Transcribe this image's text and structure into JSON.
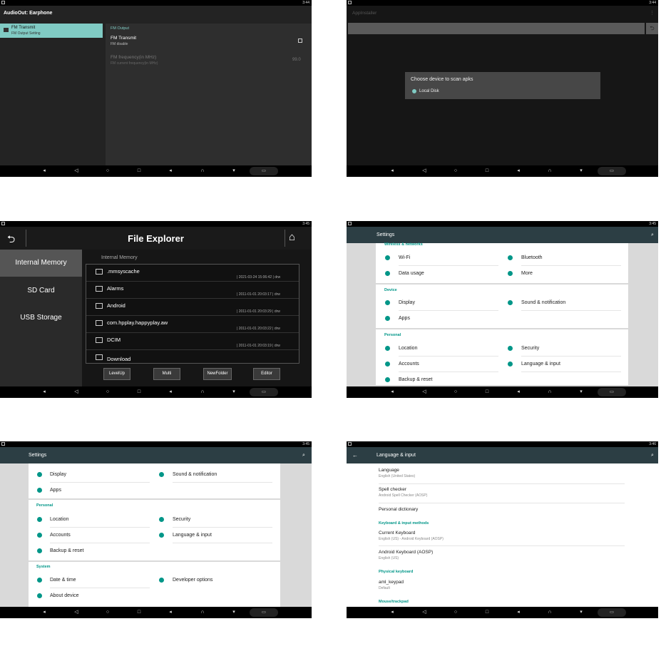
{
  "colors": {
    "accent": "#009688",
    "fm_item": "#80cbc4",
    "settings_bar": "#2c3e44"
  },
  "icons": {
    "back": "back-icon",
    "home": "home-icon",
    "recents": "recents-icon",
    "search": "search-icon",
    "folder": "folder-icon",
    "undo": "undo-icon"
  },
  "status": {
    "s1": "3:44",
    "s2": "3:44",
    "s3": "3:45",
    "s4": "3:45",
    "s5": "3:45",
    "s6": "3:46"
  },
  "fm": {
    "title": "AudioOut: Earphone",
    "left_item_title": "FM Transmit",
    "left_item_sub": "FM Output Setting",
    "section": "FM Output",
    "transmit_title": "FM Transmit",
    "transmit_sub": "FM disable",
    "freq_title": "FM frequency(in MHz)",
    "freq_sub": "FM current frequency(in MHz)",
    "freq_value": "99.0"
  },
  "apk": {
    "title": "AppInstaller",
    "dialog_title": "Choose device to scan apks",
    "option": "Local Disk"
  },
  "fe": {
    "title": "File Explorer",
    "side": [
      "Internal Memory",
      "SD Card",
      "USB Storage"
    ],
    "path": "Internal Memory",
    "files": [
      {
        "name": ".mmsyscache",
        "meta": "| 2021-03-24 15:06:42 | drw"
      },
      {
        "name": "Alarms",
        "meta": "| 2011-01-01 20:03:17 | drw"
      },
      {
        "name": "Android",
        "meta": "| 2011-01-01 20:03:29 | drw"
      },
      {
        "name": "com.hpplay.happyplay.aw",
        "meta": "| 2011-01-01 20:03:22 | drw"
      },
      {
        "name": "DCIM",
        "meta": "| 2011-01-01 20:03:19 | drw"
      },
      {
        "name": "Download",
        "meta": ""
      }
    ],
    "buttons": [
      "LevelUp",
      "Multi",
      "NewFolder",
      "Editor"
    ]
  },
  "set1": {
    "title": "Settings",
    "h1": "Wireless & networks",
    "wifi": "Wi-Fi",
    "bt": "Bluetooth",
    "data": "Data usage",
    "more": "More",
    "h2": "Device",
    "display": "Display",
    "sound": "Sound & notification",
    "apps": "Apps",
    "h3": "Personal",
    "location": "Location",
    "security": "Security",
    "accounts": "Accounts",
    "lang": "Language & input",
    "backup": "Backup & reset"
  },
  "set2": {
    "title": "Settings",
    "display": "Display",
    "sound": "Sound & notification",
    "apps": "Apps",
    "h3": "Personal",
    "location": "Location",
    "security": "Security",
    "accounts": "Accounts",
    "lang": "Language & input",
    "backup": "Backup & reset",
    "h4": "System",
    "date": "Date & time",
    "dev": "Developer options",
    "about": "About device"
  },
  "lang": {
    "title": "Language & input",
    "language": "Language",
    "language_sub": "English (United States)",
    "spell": "Spell checker",
    "spell_sub": "Android Spell Checker (AOSP)",
    "dict": "Personal dictionary",
    "h1": "Keyboard & input methods",
    "cur": "Current Keyboard",
    "cur_sub": "English (US) - Android Keyboard (AOSP)",
    "ak": "Android Keyboard (AOSP)",
    "ak_sub": "English (US)",
    "h2": "Physical keyboard",
    "aml": "aml_keypad",
    "aml_sub": "Default",
    "h3": "Mouse/trackpad"
  }
}
